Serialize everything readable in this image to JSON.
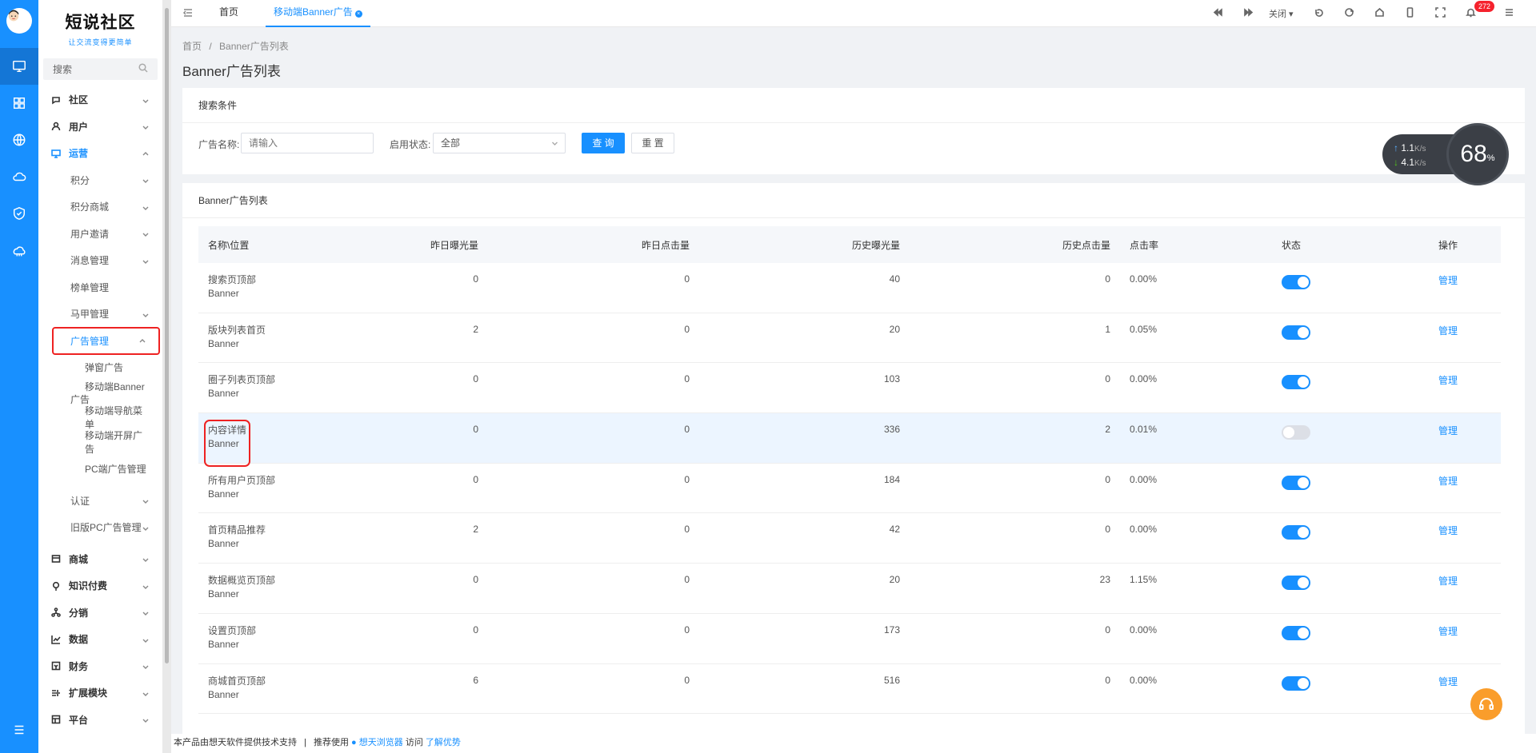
{
  "app": {
    "name": "短说社区",
    "slogan": "让交流变得更简单"
  },
  "sidebar": {
    "search_placeholder": "搜索",
    "items": [
      {
        "label": "社区",
        "icon": "chat-icon"
      },
      {
        "label": "用户",
        "icon": "user-icon"
      },
      {
        "label": "运营",
        "icon": "monitor-icon"
      },
      {
        "label": "积分"
      },
      {
        "label": "积分商城"
      },
      {
        "label": "用户邀请"
      },
      {
        "label": "消息管理"
      },
      {
        "label": "榜单管理"
      },
      {
        "label": "马甲管理"
      },
      {
        "label": "广告管理"
      },
      {
        "label": "弹窗广告"
      },
      {
        "label": "移动端Banner广告"
      },
      {
        "label": "移动端导航菜单"
      },
      {
        "label": "移动端开屏广告"
      },
      {
        "label": "PC端广告管理"
      },
      {
        "label": "认证"
      },
      {
        "label": "旧版PC广告管理"
      },
      {
        "label": "商城",
        "icon": "store-icon"
      },
      {
        "label": "知识付费",
        "icon": "bulb-icon"
      },
      {
        "label": "分销",
        "icon": "share-icon"
      },
      {
        "label": "数据",
        "icon": "chart-icon"
      },
      {
        "label": "财务",
        "icon": "wallet-icon"
      },
      {
        "label": "扩展模块",
        "icon": "plugin-icon"
      },
      {
        "label": "平台",
        "icon": "grid-icon"
      }
    ]
  },
  "topbar": {
    "tabs": [
      {
        "label": "首页"
      },
      {
        "label": "移动端Banner广告"
      }
    ],
    "close_label": "关闭",
    "notification_count": "272"
  },
  "page": {
    "breadcrumb": [
      "首页",
      "Banner广告列表"
    ],
    "title": "Banner广告列表"
  },
  "search": {
    "header": "搜索条件",
    "name_label": "广告名称:",
    "name_placeholder": "请输入",
    "status_label": "启用状态:",
    "status_value": "全部",
    "query_button": "查 询",
    "reset_button": "重 置"
  },
  "table": {
    "header": "Banner广告列表",
    "columns": [
      "名称\\位置",
      "昨日曝光量",
      "昨日点击量",
      "历史曝光量",
      "历史点击量",
      "点击率",
      "状态",
      "操作"
    ],
    "rows": [
      {
        "name": "搜索页顶部\nBanner",
        "yview": "0",
        "yclick": "0",
        "hview": "40",
        "hclick": "0",
        "rate": "0.00%",
        "enabled": true,
        "action": "管理"
      },
      {
        "name": "版块列表首页\nBanner",
        "yview": "2",
        "yclick": "0",
        "hview": "20",
        "hclick": "1",
        "rate": "0.05%",
        "enabled": true,
        "action": "管理"
      },
      {
        "name": "圈子列表页顶部\nBanner",
        "yview": "0",
        "yclick": "0",
        "hview": "103",
        "hclick": "0",
        "rate": "0.00%",
        "enabled": true,
        "action": "管理"
      },
      {
        "name": "内容详情\nBanner",
        "yview": "0",
        "yclick": "0",
        "hview": "336",
        "hclick": "2",
        "rate": "0.01%",
        "enabled": false,
        "action": "管理"
      },
      {
        "name": "所有用户页顶部\nBanner",
        "yview": "0",
        "yclick": "0",
        "hview": "184",
        "hclick": "0",
        "rate": "0.00%",
        "enabled": true,
        "action": "管理"
      },
      {
        "name": "首页精品推荐\nBanner",
        "yview": "2",
        "yclick": "0",
        "hview": "42",
        "hclick": "0",
        "rate": "0.00%",
        "enabled": true,
        "action": "管理"
      },
      {
        "name": "数据概览页顶部\nBanner",
        "yview": "0",
        "yclick": "0",
        "hview": "20",
        "hclick": "23",
        "rate": "1.15%",
        "enabled": true,
        "action": "管理"
      },
      {
        "name": "设置页顶部\nBanner",
        "yview": "0",
        "yclick": "0",
        "hview": "173",
        "hclick": "0",
        "rate": "0.00%",
        "enabled": true,
        "action": "管理"
      },
      {
        "name": "商城首页顶部\nBanner",
        "yview": "6",
        "yclick": "0",
        "hview": "516",
        "hclick": "0",
        "rate": "0.00%",
        "enabled": true,
        "action": "管理"
      }
    ]
  },
  "network": {
    "up": "1.1",
    "down": "4.1",
    "unit": "K/s",
    "percent": "68",
    "percent_sign": "%"
  },
  "footer": {
    "text1": "本产品由想天软件提供技术支持",
    "sep": "|",
    "text2": "推荐使用",
    "browser": "想天浏览器",
    "text3": "访问",
    "link": "了解优势"
  },
  "colors": {
    "primary": "#1890ff",
    "highlight": "#e22222",
    "rail": "#1890ff"
  }
}
